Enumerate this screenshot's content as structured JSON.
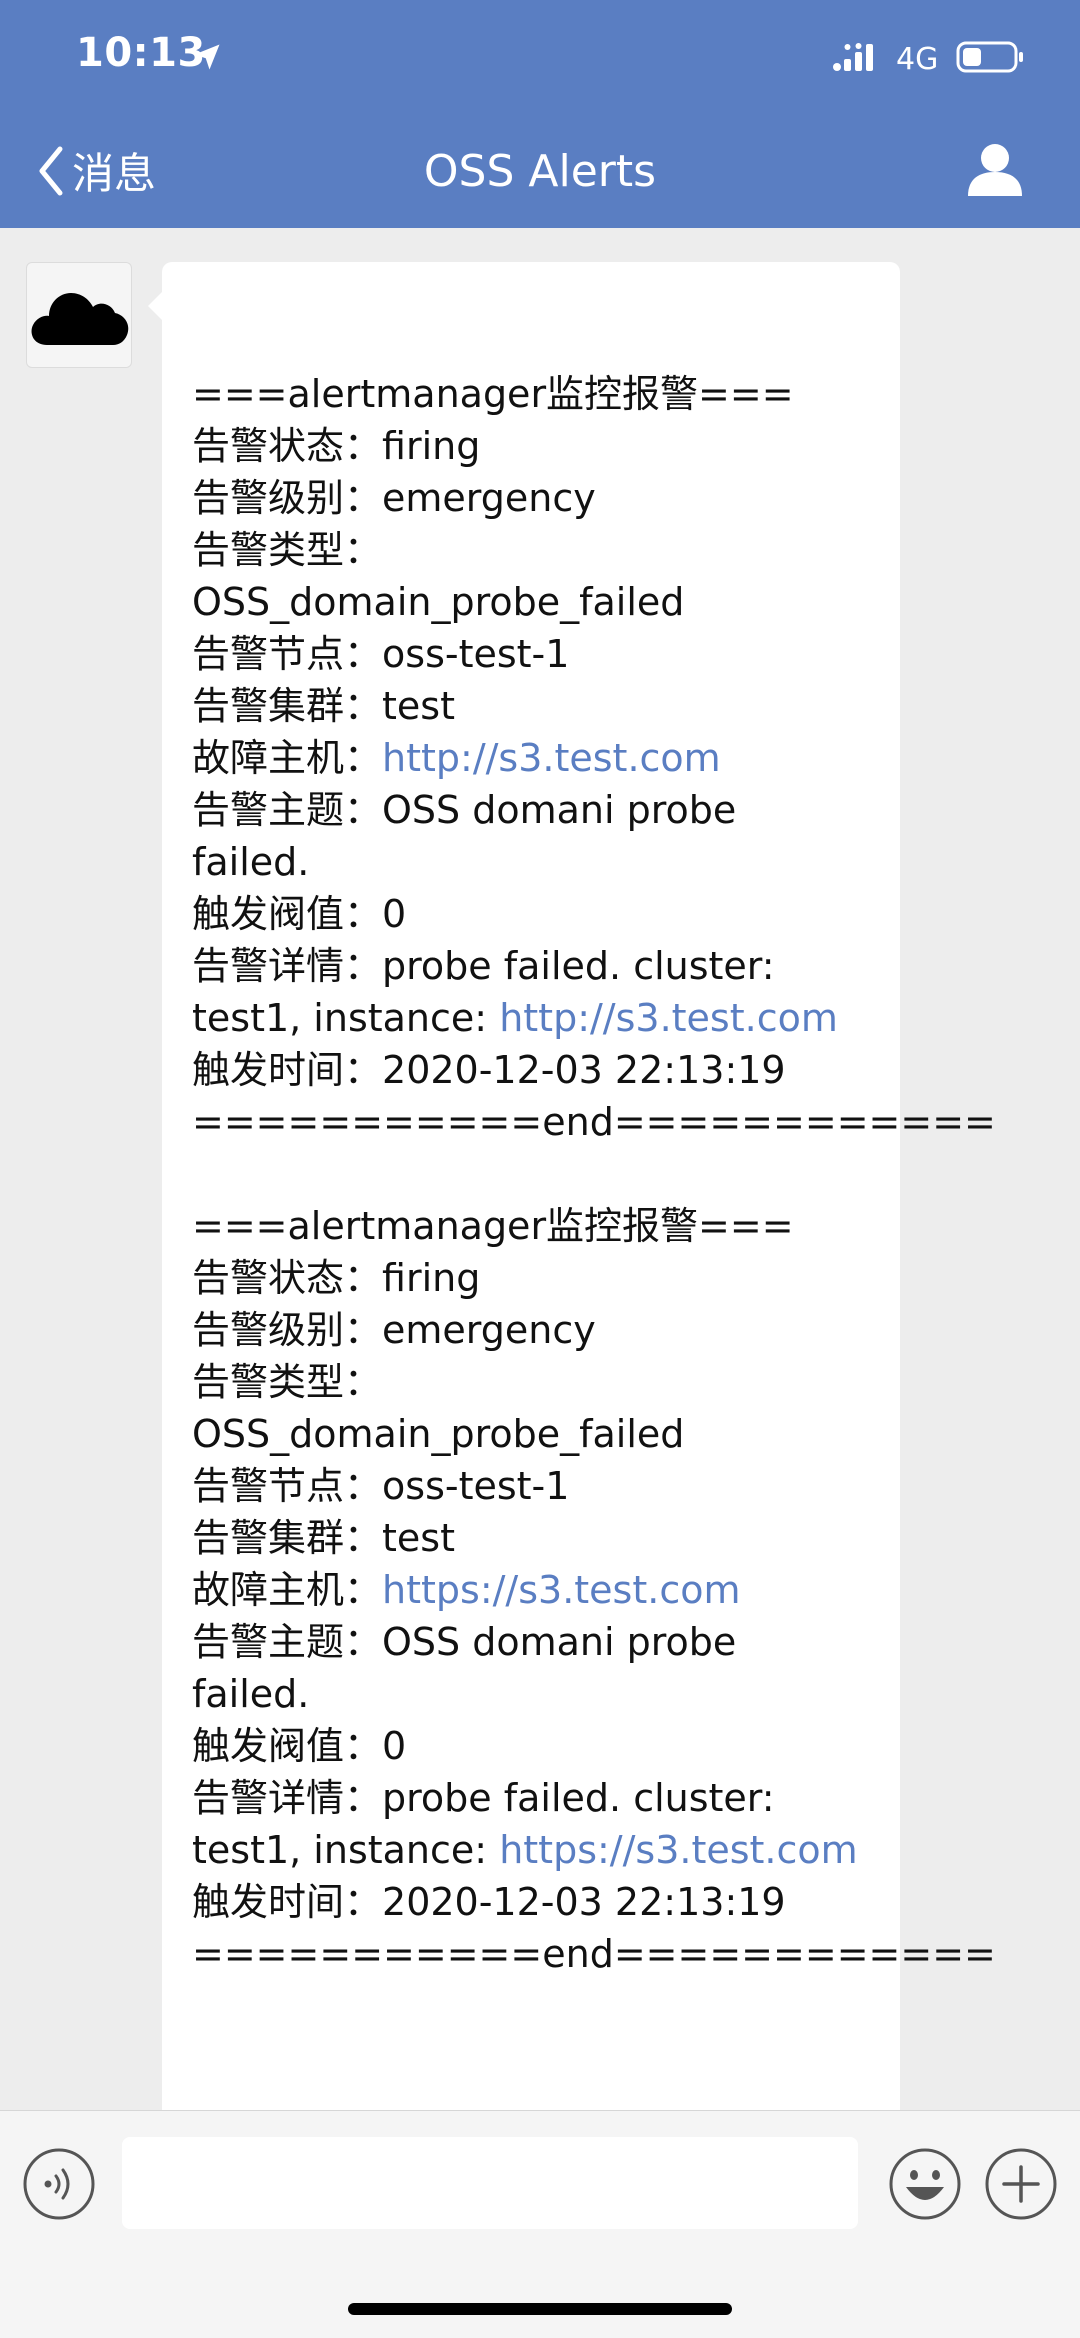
{
  "status_bar": {
    "time": "10:13",
    "network": "4G"
  },
  "nav": {
    "back_label": "消息",
    "title": "OSS Alerts"
  },
  "colors": {
    "header": "#5a7ec2",
    "link": "#5a7ec2",
    "background": "#ededed"
  },
  "messages": [
    {
      "header": "===alertmanager监控报警===",
      "status": {
        "label": "告警状态：",
        "value": "firing"
      },
      "level": {
        "label": "告警级别：",
        "value": "emergency"
      },
      "type_label": "告警类型：",
      "type_value": "OSS_domain_probe_failed",
      "node": {
        "label": "告警节点：",
        "value": "oss-test-1"
      },
      "cluster": {
        "label": "告警集群：",
        "value": "test"
      },
      "host": {
        "label": "故障主机：",
        "value": "http://s3.test.com"
      },
      "subject": {
        "label": "告警主题：",
        "value": "OSS domani probe",
        "cont": "failed."
      },
      "threshold": {
        "label": "触发阀值：",
        "value": "0"
      },
      "detail": {
        "label": "告警详情：",
        "value": "probe failed. cluster:",
        "cont_prefix": "test1, instance: ",
        "cont_link": "http://s3.test.com"
      },
      "time": {
        "label": "触发时间：",
        "value": "2020-12-03 22:13:19"
      },
      "footer": "===========end============"
    },
    {
      "header": "===alertmanager监控报警===",
      "status": {
        "label": "告警状态：",
        "value": "firing"
      },
      "level": {
        "label": "告警级别：",
        "value": "emergency"
      },
      "type_label": "告警类型：",
      "type_value": "OSS_domain_probe_failed",
      "node": {
        "label": "告警节点：",
        "value": "oss-test-1"
      },
      "cluster": {
        "label": "告警集群：",
        "value": "test"
      },
      "host": {
        "label": "故障主机：",
        "value": "https://s3.test.com"
      },
      "subject": {
        "label": "告警主题：",
        "value": "OSS domani probe",
        "cont": "failed."
      },
      "threshold": {
        "label": "触发阀值：",
        "value": "0"
      },
      "detail": {
        "label": "告警详情：",
        "value": "probe failed. cluster:",
        "cont_prefix": "test1, instance: ",
        "cont_link": "https://s3.test.com"
      },
      "time": {
        "label": "触发时间：",
        "value": "2020-12-03 22:13:19"
      },
      "footer": "===========end============"
    }
  ],
  "input": {
    "placeholder": ""
  },
  "icons": {
    "location": "location-arrow-icon",
    "signal": "signal-icon",
    "battery": "battery-icon",
    "back": "chevron-left-icon",
    "profile": "person-icon",
    "avatar": "cloud-icon",
    "voice": "voice-icon",
    "emoji": "emoji-icon",
    "plus": "plus-icon"
  }
}
